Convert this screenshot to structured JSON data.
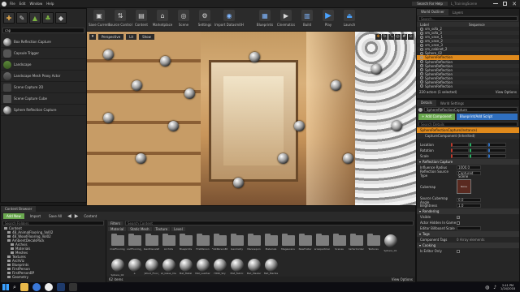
{
  "window": {
    "menu": [
      "File",
      "Edit",
      "Window",
      "Help"
    ],
    "tab_title": "L_TrainingScene",
    "search_hint": "Search For Help"
  },
  "modes": {
    "search_value": "cap",
    "items": [
      "Box Reflection Capture",
      "Capsule Trigger",
      "Landscape",
      "Landscape Mesh Proxy Actor",
      "Scene Capture 2D",
      "Scene Capture Cube",
      "Sphere Reflection Capture"
    ]
  },
  "toolbar": {
    "buttons": [
      "Save Current",
      "Source Control",
      "Content",
      "Marketplace",
      "Scene",
      "Settings",
      "Import DatasmitH",
      "Blueprints",
      "Cinematics",
      "Build",
      "Play",
      "Launch"
    ]
  },
  "viewport": {
    "perspective_label": "Perspective",
    "lit_label": "Lit",
    "show_label": "Show"
  },
  "outliner": {
    "tabs": [
      "World Outliner",
      "Layers"
    ],
    "search_placeholder": "Search...",
    "col_label": "Label",
    "col_type": "Sequence",
    "rows": [
      "sm_sofa_2",
      "sm_sofa_3",
      "sm_vase_1",
      "sm_vase_2",
      "sm_vase_3",
      "sm_cabinet_2",
      "Sphere_02",
      "SphereReflection",
      "SphereReflection",
      "SphereReflection",
      "SphereReflection",
      "SphereReflection",
      "SphereReflection",
      "SphereReflection",
      "SphereReflection"
    ],
    "selected_index": 7,
    "footer": "220 actors (1 selected)",
    "view_options": "View Options"
  },
  "details": {
    "tabs": [
      "Details",
      "World Settings"
    ],
    "name_value": "SphereReflectionCapture",
    "add_component": "+ Add Component",
    "blueprint_script": "Blueprint/Add Script",
    "search_placeholder": "Search Details",
    "component_root": "SphereReflectionCapture(Instance)",
    "component_child": "CaptureComponent (Inherited)",
    "transform_rows": [
      "Location",
      "Rotation",
      "Scale"
    ],
    "section_capture": "Reflection Capture",
    "capture_rows": [
      {
        "label": "Influence Radius",
        "value": "1000.0"
      },
      {
        "label": "Reflection Source Type",
        "value": "Captured Scene"
      },
      {
        "label": "Cubemap",
        "value": "None"
      },
      {
        "label": "Source Cubemap Angle",
        "value": "0.0"
      },
      {
        "label": "Brightness",
        "value": "1.0"
      }
    ],
    "section_rendering": "Rendering",
    "rendering_rows": [
      "Visible",
      "Actor Hidden In Game",
      "Editor Billboard Scale"
    ],
    "section_tags": "Tags",
    "tags_row": "Component Tags",
    "tags_value": "0 Array elements",
    "section_cooking": "Cooking",
    "cooking_row": "Is Editor Only"
  },
  "content_browser": {
    "tab": "Content Browser",
    "add_new": "Add New",
    "import": "Import",
    "save_all": "Save All",
    "path": "Content",
    "filters": "Filters",
    "search_placeholder": "Search Content",
    "filter_chips": [
      "Material",
      "Static Mesh",
      "Texture",
      "Level"
    ],
    "folder_search": "Search Folders",
    "tree": [
      "Content",
      "4B_AnimalFlooring_Vol02",
      "4B_WoodFlooring_Vol02",
      "AmbientDecalsPack",
      "Archvis",
      "Materials",
      "Meshes",
      "Textures",
      "ArchViz",
      "Blueprints",
      "FirstPerson",
      "FirstPersonBP",
      "Geometry"
    ],
    "folders": [
      "4B_AnimalFlooring_Vol02",
      "4B_WoodFlooring_Vol02",
      "AmbientDecalsPack",
      "ArchVis",
      "Blueprints",
      "FirstPerson",
      "FirstPersonBP",
      "Geometry",
      "Mannequin",
      "Materials",
      "Megascans",
      "NewFolder",
      "ParisApartment",
      "Scenes",
      "StarterContent",
      "Textures",
      "Sphere_01",
      "Sphere_02"
    ],
    "assets": [
      "a",
      "Mat_Wood_Floor_Oak",
      "Mat_Glass_Clear",
      "Mat_Metal",
      "Mat_Leather",
      "HDRI_Sky",
      "Mat_Fabric",
      "Mat_Plaster",
      "Mat_Marble"
    ],
    "footer": "62 items",
    "view_options": "View Options"
  },
  "taskbar": {
    "time": "2:41 PM",
    "date": "1/24/2018"
  },
  "colors": {
    "accent": "#e08a1c",
    "panel_bg": "#262626",
    "dark": "#1b1b1b",
    "green": "#6aa84f",
    "blue_btn": "#2f6fbf"
  }
}
